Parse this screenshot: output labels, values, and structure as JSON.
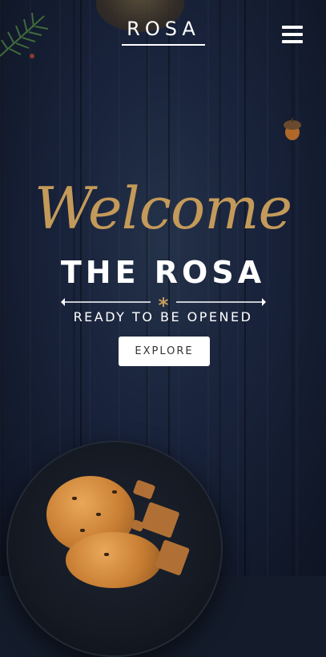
{
  "header": {
    "logo_text": "ROSA",
    "menu_icon": "hamburger-menu-icon"
  },
  "hero": {
    "script_title": "Welcome",
    "title": "THE ROSA",
    "subtitle": "READY TO BE OPENED",
    "divider_icon": "asterisk-icon",
    "cta_label": "EXPLORE"
  },
  "colors": {
    "accent_gold": "#c49a5a",
    "background_navy": "#18223a",
    "text_white": "#ffffff",
    "button_bg": "#ffffff"
  }
}
